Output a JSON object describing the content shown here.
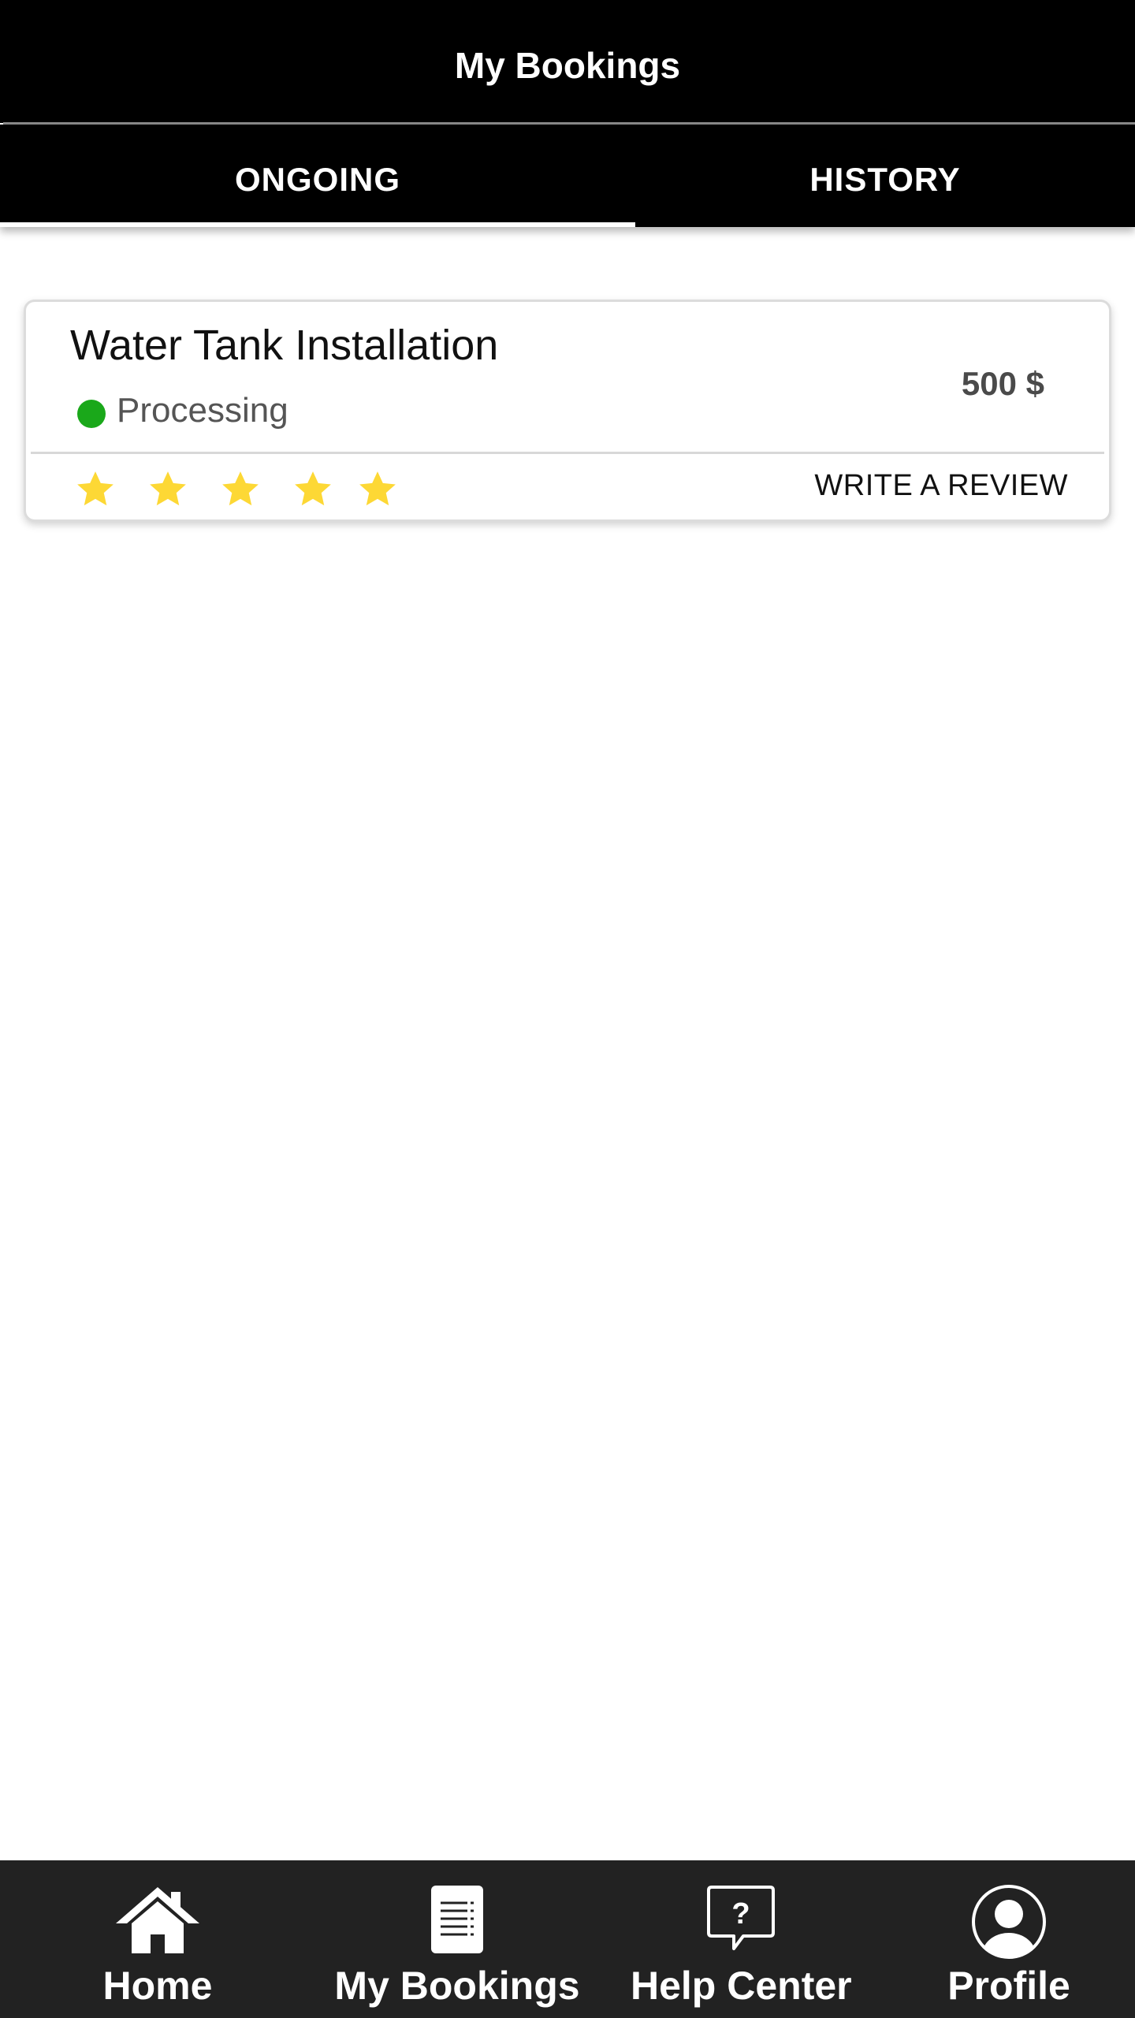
{
  "header": {
    "title": "My Bookings"
  },
  "tabs": [
    {
      "label": "ONGOING",
      "active": true
    },
    {
      "label": "HISTORY",
      "active": false
    }
  ],
  "booking": {
    "title": "Water Tank Installation",
    "status": "Processing",
    "status_color": "#1aa81a",
    "price": "500 $",
    "rating": {
      "max": 5,
      "filled": 5,
      "star_color": "#fdd835"
    },
    "review_label": "WRITE A REVIEW"
  },
  "bottom_nav": {
    "items": [
      {
        "label": "Home",
        "icon": "home-icon"
      },
      {
        "label": "My Bookings",
        "icon": "document-icon"
      },
      {
        "label": "Help Center",
        "icon": "help-chat-icon"
      },
      {
        "label": "Profile",
        "icon": "user-avatar-icon"
      }
    ]
  }
}
